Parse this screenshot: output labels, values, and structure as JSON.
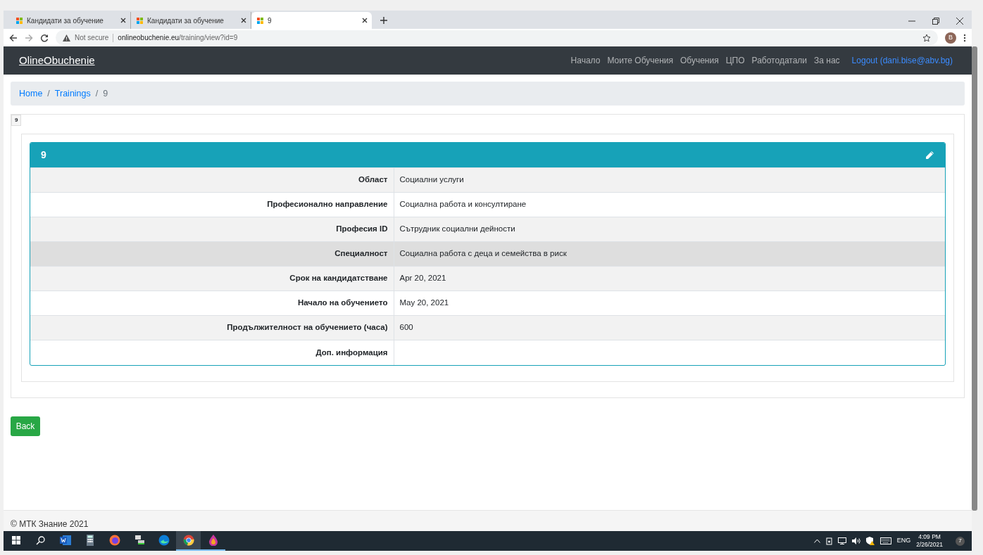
{
  "browser": {
    "tabs": [
      {
        "title": "Кандидати за обучение",
        "selected": false
      },
      {
        "title": "Кандидати за обучение",
        "selected": false
      },
      {
        "title": "9",
        "selected": true
      }
    ],
    "security": "Not secure",
    "url_host": "onlineobuchenie.eu",
    "url_path": "/training/view?id=9",
    "profile_initial": "B"
  },
  "navbar": {
    "brand": "OlineObuchenie",
    "links": [
      {
        "label": "Начало",
        "kind": "nav"
      },
      {
        "label": "Моите Обучения",
        "kind": "nav"
      },
      {
        "label": "Обучения",
        "kind": "nav"
      },
      {
        "label": "ЦПО",
        "kind": "nav"
      },
      {
        "label": "Работодатали",
        "kind": "nav"
      },
      {
        "label": "За нас",
        "kind": "nav"
      },
      {
        "label": "Logout (dani.bise@abv.bg)",
        "kind": "logout"
      }
    ]
  },
  "breadcrumb": [
    {
      "kind": "crumb",
      "label": "Home",
      "active": false
    },
    {
      "kind": "separator",
      "label": "/"
    },
    {
      "kind": "crumb",
      "label": "Trainings",
      "active": false
    },
    {
      "kind": "separator",
      "label": "/"
    },
    {
      "kind": "crumb",
      "label": "9",
      "active": true
    }
  ],
  "page_tag": "9",
  "detail": {
    "title": "9",
    "rows": [
      {
        "label": "Област",
        "value": "Социални услуги",
        "highlighted": false
      },
      {
        "label": "Професионално направление",
        "value": "Социална работа и консултиране",
        "highlighted": false
      },
      {
        "label": "Професия ID",
        "value": "Сътрудник социални дейности",
        "highlighted": false
      },
      {
        "label": "Специалност",
        "value": "Социална работа с деца и семейства в риск",
        "highlighted": true
      },
      {
        "label": "Срок на кандидатстване",
        "value": "Apr 20, 2021",
        "highlighted": false
      },
      {
        "label": "Начало на обучението",
        "value": "May 20, 2021",
        "highlighted": false
      },
      {
        "label": "Продължителност на обучението (часа)",
        "value": "600",
        "highlighted": false
      },
      {
        "label": "Доп. информация",
        "highlighted": false
      }
    ]
  },
  "back_button": "Back",
  "footer": "© МТК Знание 2021",
  "taskbar": {
    "apps": [
      {
        "kind": "word",
        "running": false,
        "selected": false
      },
      {
        "kind": "calculator",
        "running": false,
        "selected": false
      },
      {
        "kind": "firefox",
        "running": false,
        "selected": false
      },
      {
        "kind": "network",
        "running": false,
        "selected": false
      },
      {
        "kind": "edge",
        "running": false,
        "selected": false
      },
      {
        "kind": "chrome",
        "running": true,
        "selected": true
      },
      {
        "kind": "drop",
        "running": true,
        "selected": false
      }
    ],
    "language": "ENG",
    "time": "4:09 PM",
    "date": "2/26/2021",
    "notifications": "7"
  }
}
